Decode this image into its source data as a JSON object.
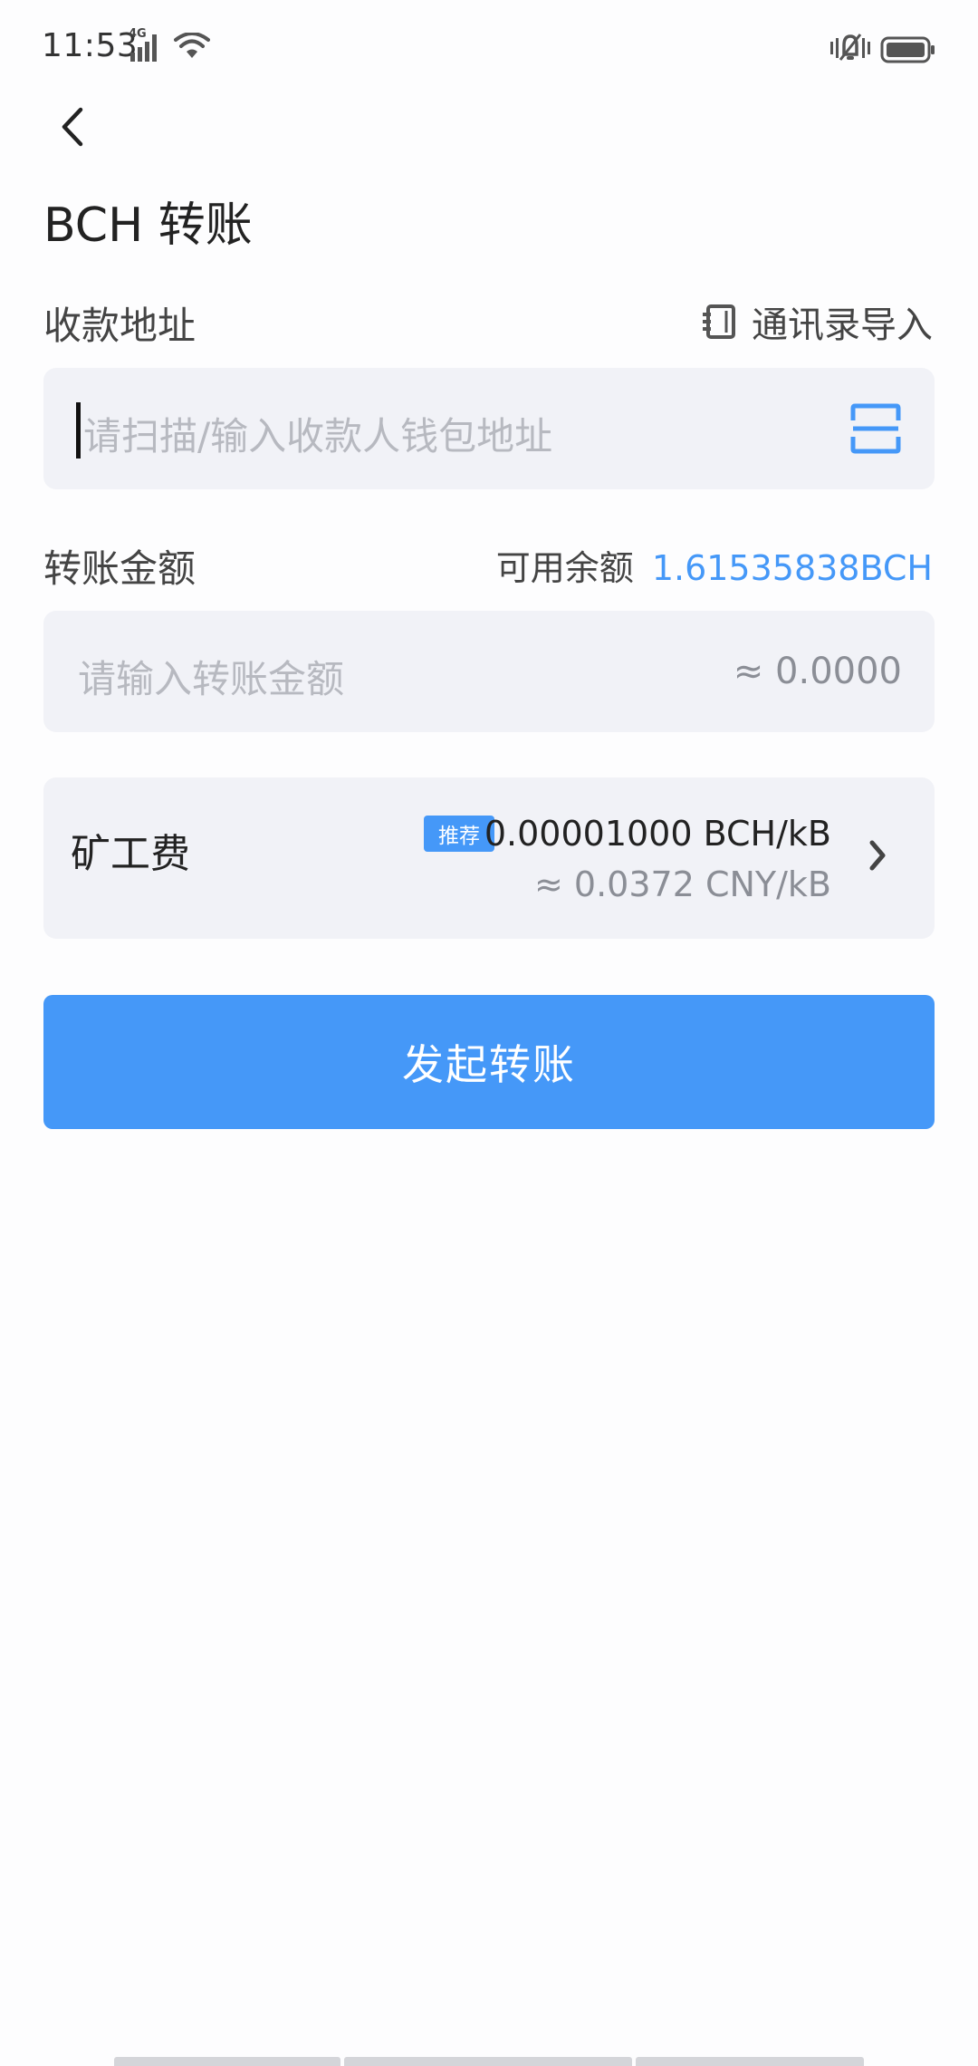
{
  "status_bar": {
    "time": "11:53",
    "network": "4G"
  },
  "header": {
    "title": "BCH 转账"
  },
  "address_section": {
    "label": "收款地址",
    "contacts_link": "通讯录导入",
    "placeholder": "请扫描/输入收款人钱包地址"
  },
  "amount_section": {
    "label": "转账金额",
    "balance_label": "可用余额",
    "balance_value": "1.61535838BCH",
    "placeholder": "请输入转账金额",
    "approx_value": "≈ 0.0000"
  },
  "fee_section": {
    "label": "矿工费",
    "badge": "推荐",
    "fee_bch": "0.00001000 BCH/kB",
    "fee_cny": "≈ 0.0372 CNY/kB"
  },
  "actions": {
    "submit_label": "发起转账"
  },
  "colors": {
    "accent": "#4598f8",
    "field_bg": "#f1f2f7",
    "placeholder": "#b7b9c0"
  }
}
